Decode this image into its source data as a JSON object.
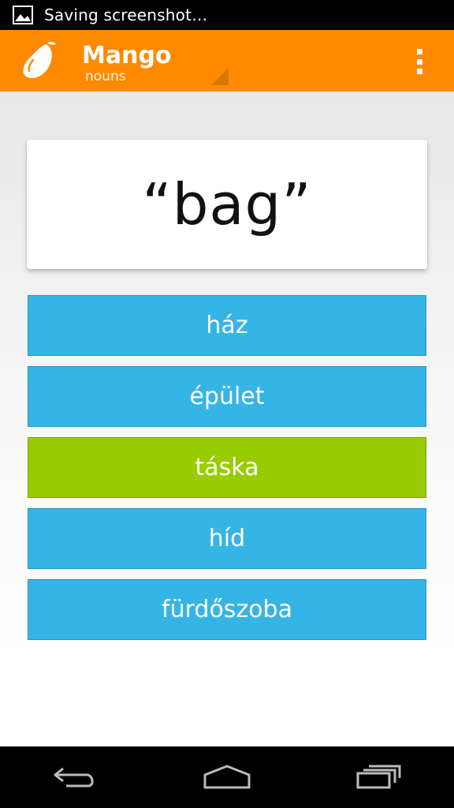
{
  "status_bar": {
    "notification_text": "Saving screenshot…",
    "icon": "image-icon"
  },
  "action_bar": {
    "title": "Mango",
    "subtitle": "nouns",
    "logo_icon": "mango-logo-icon",
    "menu_icon": "overflow-menu-icon",
    "background_color": "#ff8a00"
  },
  "quiz": {
    "prompt": "“bag”",
    "answers": [
      {
        "label": "ház",
        "state": "default"
      },
      {
        "label": "épület",
        "state": "default"
      },
      {
        "label": "táska",
        "state": "correct"
      },
      {
        "label": "híd",
        "state": "default"
      },
      {
        "label": "fürdőszoba",
        "state": "default"
      }
    ],
    "answer_color": "#35b5e5",
    "correct_color": "#99cc00"
  },
  "nav_bar": {
    "back_icon": "back-icon",
    "home_icon": "home-icon",
    "recents_icon": "recents-icon"
  }
}
